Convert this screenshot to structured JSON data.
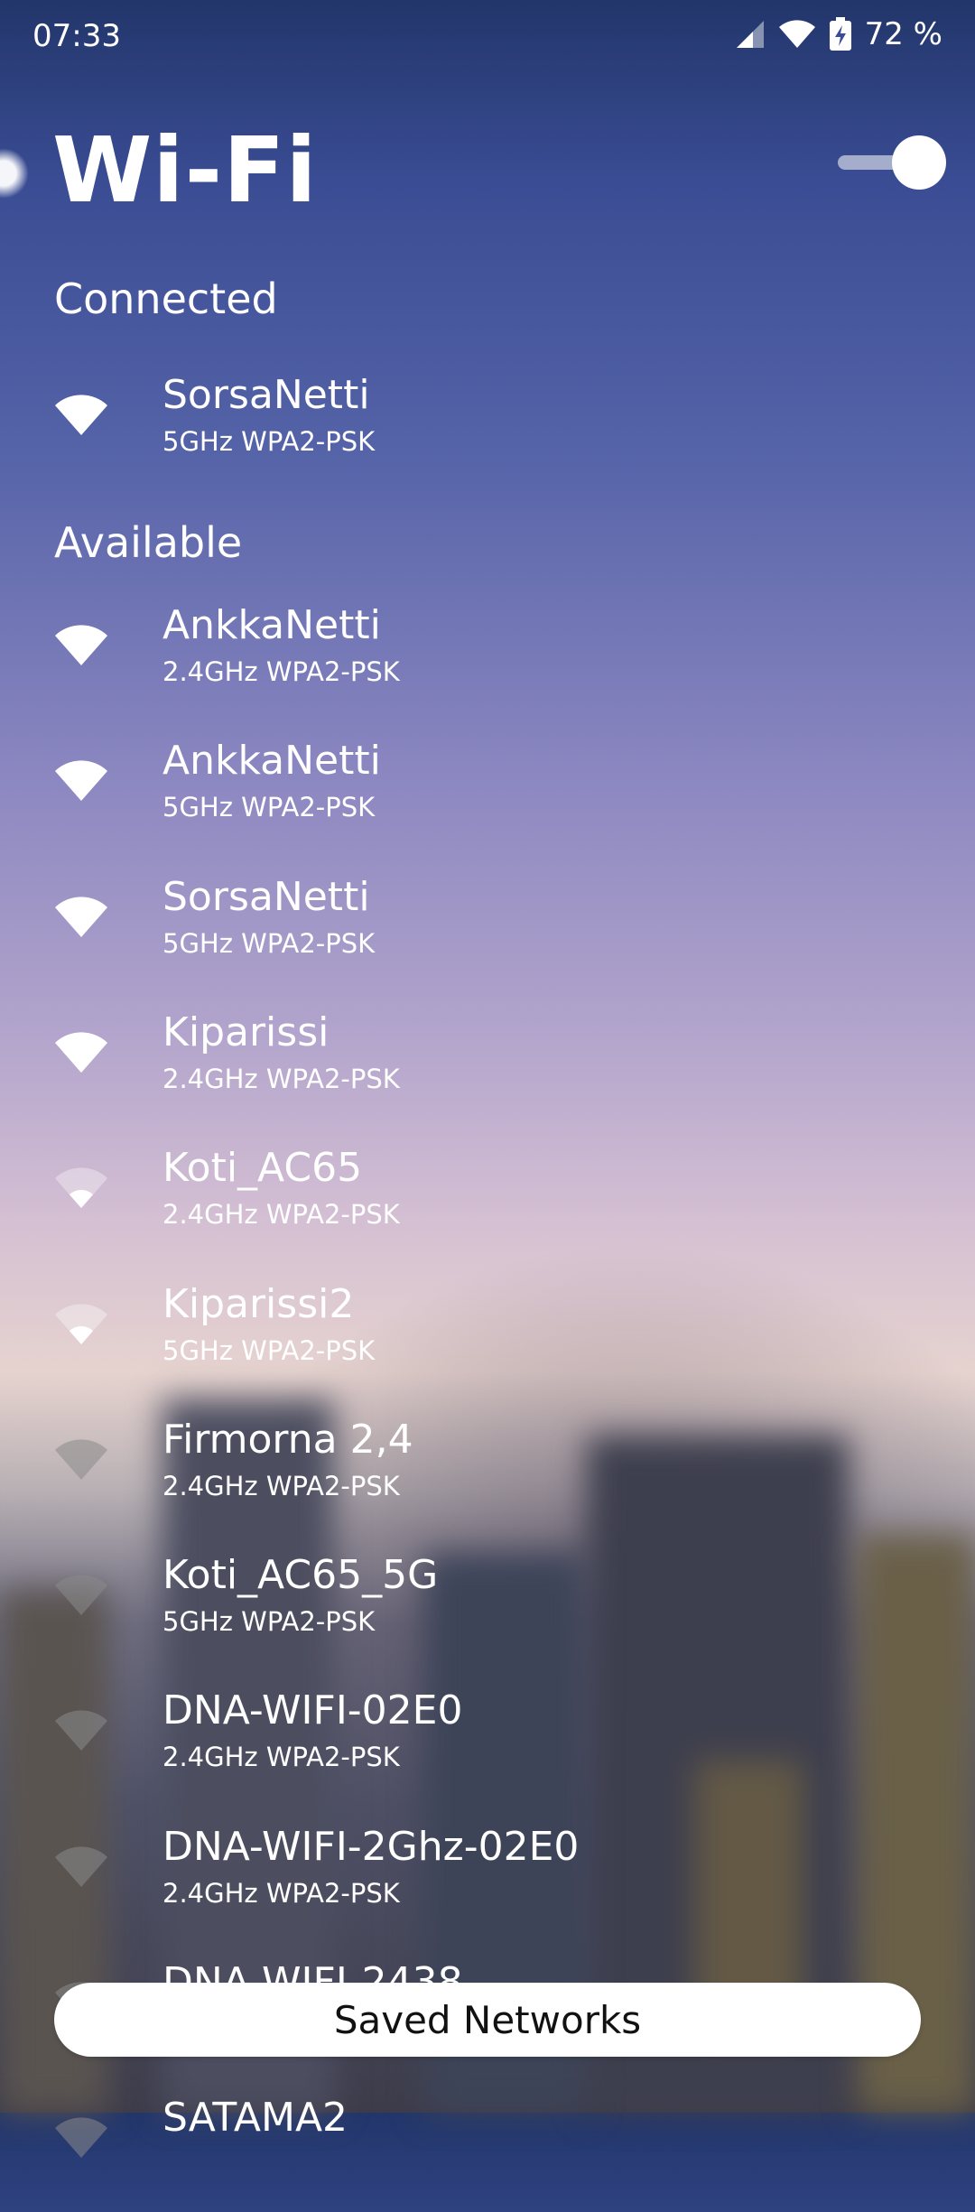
{
  "status_bar": {
    "time": "07:33",
    "battery_percent": "72 %",
    "icons": [
      "signal-icon",
      "wifi-status-icon",
      "battery-charging-icon"
    ]
  },
  "header": {
    "title": "Wi-Fi",
    "toggle_on": true
  },
  "connected": {
    "heading": "Connected",
    "networks": [
      {
        "name": "SorsaNetti",
        "details": "5GHz WPA2-PSK",
        "signal": 1.0
      }
    ]
  },
  "available": {
    "heading": "Available",
    "networks": [
      {
        "name": "AnkkaNetti",
        "details": "2.4GHz WPA2-PSK",
        "signal": 1.0
      },
      {
        "name": "AnkkaNetti",
        "details": "5GHz WPA2-PSK",
        "signal": 1.0
      },
      {
        "name": "SorsaNetti",
        "details": "5GHz WPA2-PSK",
        "signal": 1.0
      },
      {
        "name": "Kiparissi",
        "details": "2.4GHz WPA2-PSK",
        "signal": 0.75
      },
      {
        "name": "Koti_AC65",
        "details": "2.4GHz WPA2-PSK",
        "signal": 0.5
      },
      {
        "name": "Kiparissi2",
        "details": "5GHz WPA2-PSK",
        "signal": 0.5
      },
      {
        "name": "Firmorna 2,4",
        "details": "2.4GHz WPA2-PSK",
        "signal": 0.25
      },
      {
        "name": "Koti_AC65_5G",
        "details": "5GHz WPA2-PSK",
        "signal": 0.25
      },
      {
        "name": "DNA-WIFI-02E0",
        "details": "2.4GHz WPA2-PSK",
        "signal": 0.25
      },
      {
        "name": "DNA-WIFI-2Ghz-02E0",
        "details": "2.4GHz WPA2-PSK",
        "signal": 0.25
      },
      {
        "name": "DNA-WIFI-2438",
        "details": "",
        "signal": 0.25
      },
      {
        "name": "SATAMA2",
        "details": "",
        "signal": 0.25
      }
    ]
  },
  "footer": {
    "saved_networks_label": "Saved Networks"
  },
  "colors": {
    "text": "#ffffff",
    "button_bg": "#ffffff",
    "button_text": "#111111"
  }
}
